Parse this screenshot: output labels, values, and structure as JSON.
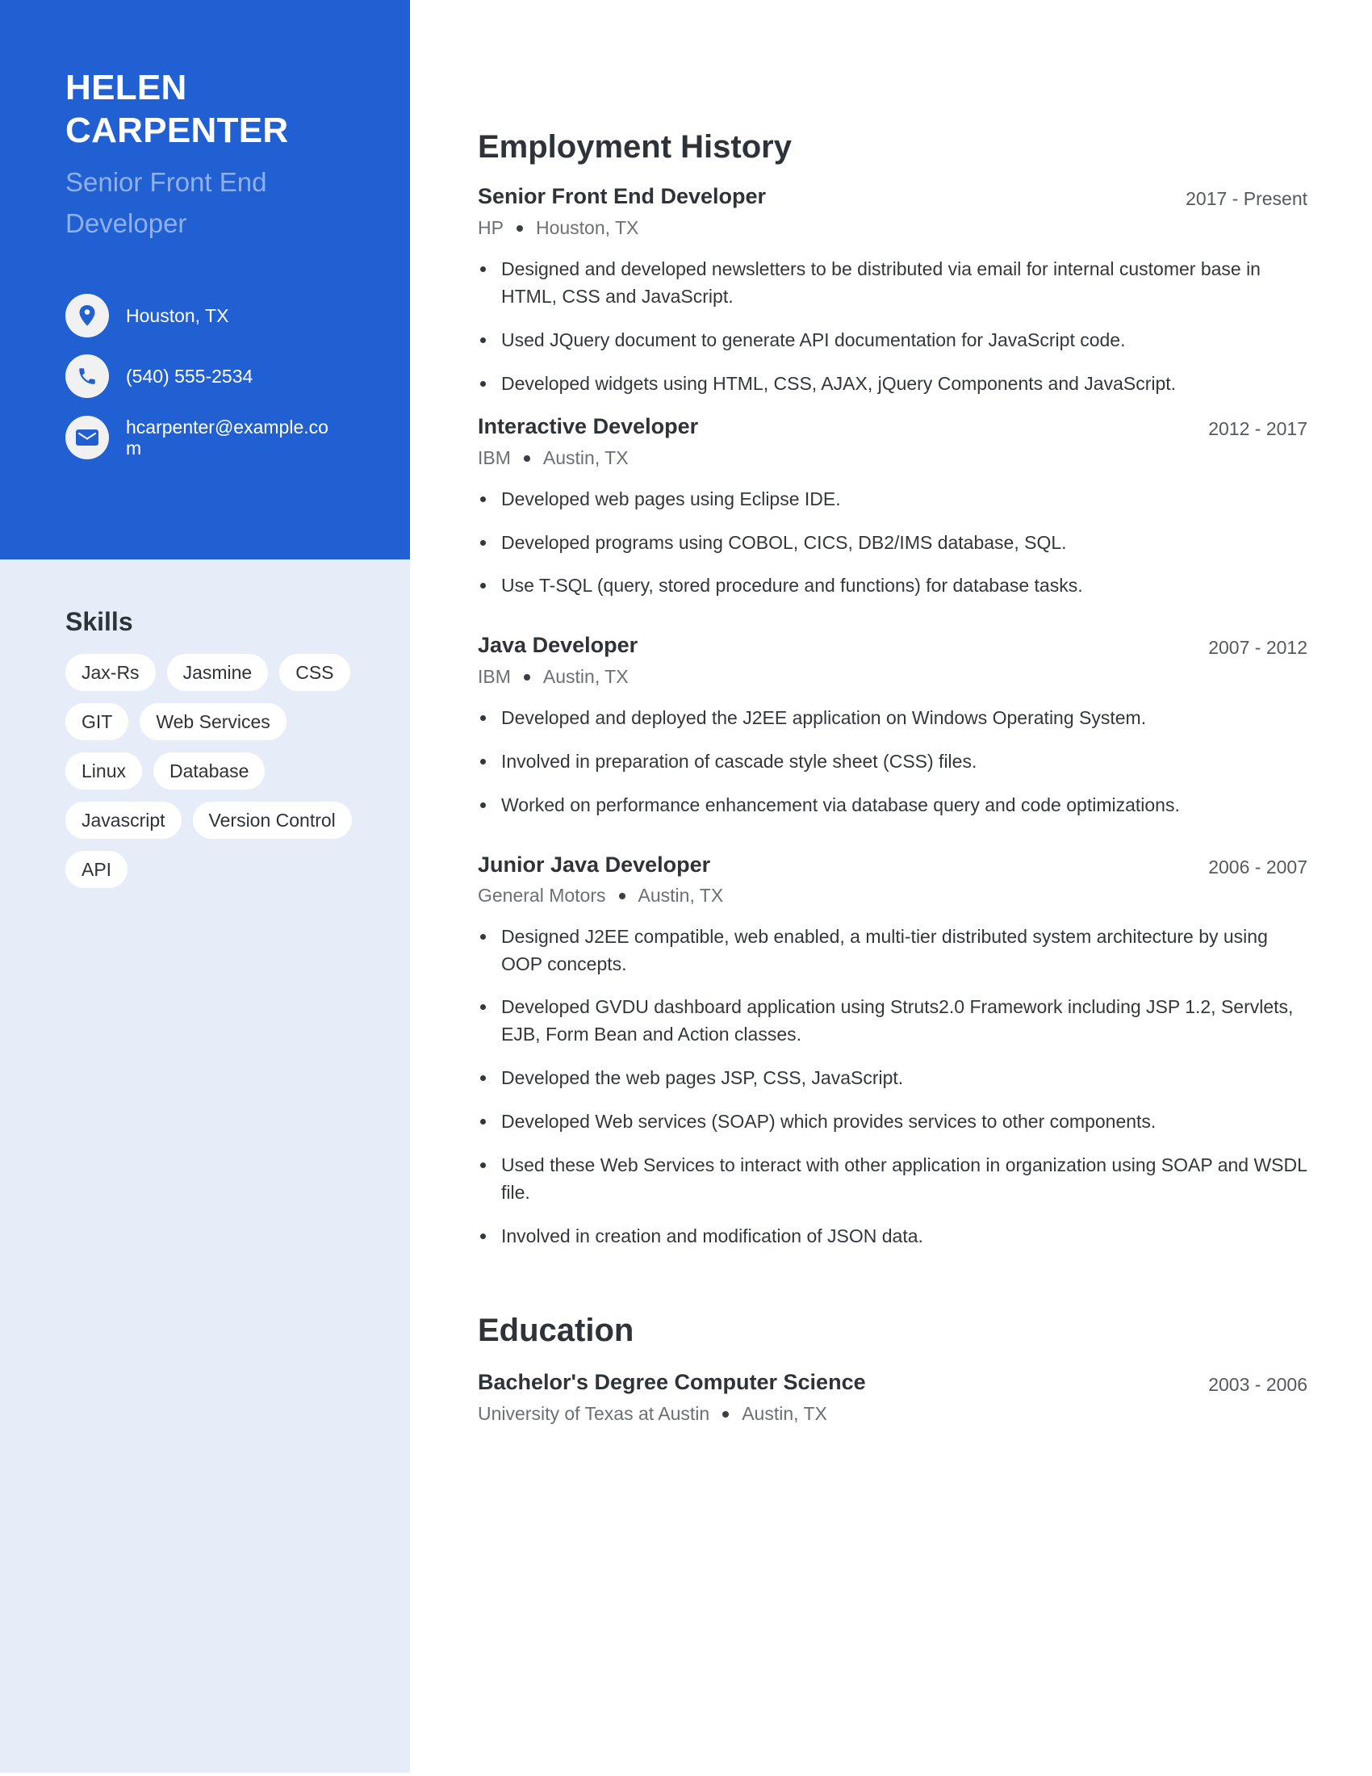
{
  "profile": {
    "name_line1": "HELEN",
    "name_line2": "CARPENTER",
    "title": "Senior Front End Developer",
    "contacts": [
      {
        "icon": "map-pin-icon",
        "text": "Houston, TX"
      },
      {
        "icon": "phone-icon",
        "text": "(540) 555-2534"
      },
      {
        "icon": "mail-icon",
        "text": "hcarpenter@example.com"
      }
    ]
  },
  "skills": {
    "heading": "Skills",
    "items": [
      "Jax-Rs",
      "Jasmine",
      "CSS",
      "GIT",
      "Web Services",
      "Linux",
      "Database",
      "Javascript",
      "Version Control",
      "API"
    ]
  },
  "employment": {
    "heading": "Employment History",
    "jobs": [
      {
        "title": "Senior Front End Developer",
        "dates": "2017 - Present",
        "company": "HP",
        "location": "Houston, TX",
        "bullets": [
          "Designed and developed newsletters to be distributed via email for internal customer base in HTML, CSS and JavaScript.",
          "Used JQuery document to generate API documentation for JavaScript code.",
          "Developed widgets using HTML, CSS, AJAX, jQuery Components and JavaScript."
        ]
      },
      {
        "title": "Interactive Developer",
        "dates": "2012 - 2017",
        "company": "IBM",
        "location": "Austin, TX",
        "bullets": [
          "Developed web pages using Eclipse IDE.",
          "Developed programs using COBOL, CICS, DB2/IMS database, SQL.",
          "Use T-SQL (query, stored procedure and functions) for database tasks."
        ]
      },
      {
        "title": "Java Developer",
        "dates": "2007 - 2012",
        "company": "IBM",
        "location": "Austin, TX",
        "bullets": [
          "Developed and deployed the J2EE application on Windows Operating System.",
          "Involved in preparation of cascade style sheet (CSS) files.",
          "Worked on performance enhancement via database query and code optimizations."
        ]
      },
      {
        "title": "Junior Java Developer",
        "dates": "2006 - 2007",
        "company": "General Motors",
        "location": "Austin, TX",
        "bullets": [
          "Designed J2EE compatible, web enabled, a multi-tier distributed system architecture by using OOP concepts.",
          "Developed GVDU dashboard application using Struts2.0 Framework including JSP 1.2, Servlets, EJB, Form Bean and Action classes.",
          "Developed the web pages JSP, CSS, JavaScript.",
          "Developed Web services (SOAP) which provides services to other components.",
          "Used these Web Services to interact with other application in organization using SOAP and WSDL file.",
          "Involved in creation and modification of JSON data."
        ]
      }
    ]
  },
  "education": {
    "heading": "Education",
    "items": [
      {
        "degree": "Bachelor's Degree Computer Science",
        "dates": "2003 - 2006",
        "school": "University of Texas at Austin",
        "location": "Austin, TX"
      }
    ]
  },
  "colors": {
    "accent": "#2160d3",
    "sidebar_bg": "#e6edf9",
    "subtitle": "#8fb0ef",
    "text": "#2e3339"
  }
}
